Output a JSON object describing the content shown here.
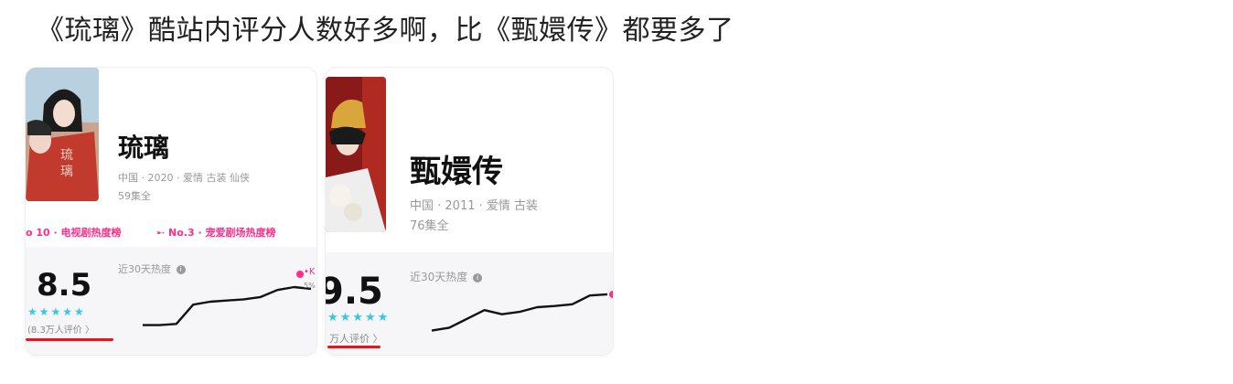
{
  "post": {
    "text": "《琉璃》酷站内评分人数好多啊，比《甄嬛传》都要多了"
  },
  "cards": [
    {
      "title": "琉璃",
      "meta": "中国 · 2020 · 爱情 古装 仙侠",
      "episodes": "59集全",
      "ranks": [
        "o 10 · 电视剧热度榜",
        "➸ No.3 · 宠爱剧场热度榜"
      ],
      "score": "8.5",
      "stars": "★★★★★",
      "review_count": "(8.3万人评价 〉",
      "heat_label": "近30天热度",
      "info_icon": "i",
      "side_mark": "•K",
      "pct_mark": "5%",
      "trend": [
        0.9,
        0.9,
        0.88,
        0.55,
        0.5,
        0.48,
        0.46,
        0.42,
        0.3,
        0.25,
        0.28
      ]
    },
    {
      "title": "甄嬛传",
      "meta": "中国 · 2011 · 爱情 古装",
      "episodes": "76集全",
      "score": "9.5",
      "stars": "★★★★★",
      "review_count": "万人评价 〉",
      "heat_label": "近30天热度",
      "info_icon": "i",
      "trend": [
        0.9,
        0.85,
        0.7,
        0.55,
        0.62,
        0.58,
        0.5,
        0.48,
        0.45,
        0.3,
        0.28
      ]
    }
  ],
  "colors": {
    "accent_pink": "#ff2e8a",
    "star_cyan": "#33c8e6",
    "underline_red": "#e8141e"
  }
}
